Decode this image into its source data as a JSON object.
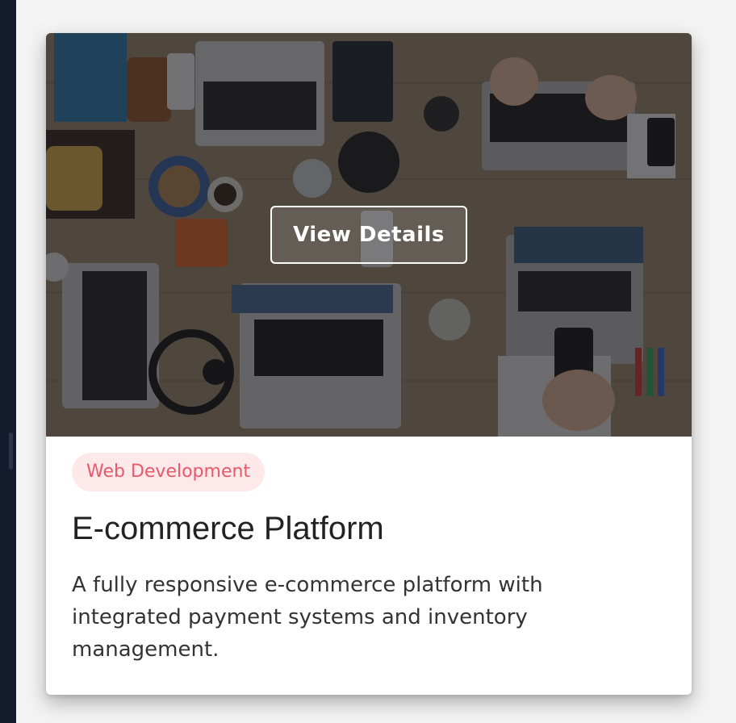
{
  "card": {
    "image_alt": "Workspace with laptops and devices on a table",
    "overlay_button": "View Details",
    "category_badge": "Web Development",
    "title": "E-commerce Platform",
    "description": "A fully responsive e-commerce platform with integrated payment systems and inventory management."
  },
  "colors": {
    "badge_bg": "#fde8ea",
    "badge_text": "#e65a6a",
    "rail": "#141b2d"
  }
}
